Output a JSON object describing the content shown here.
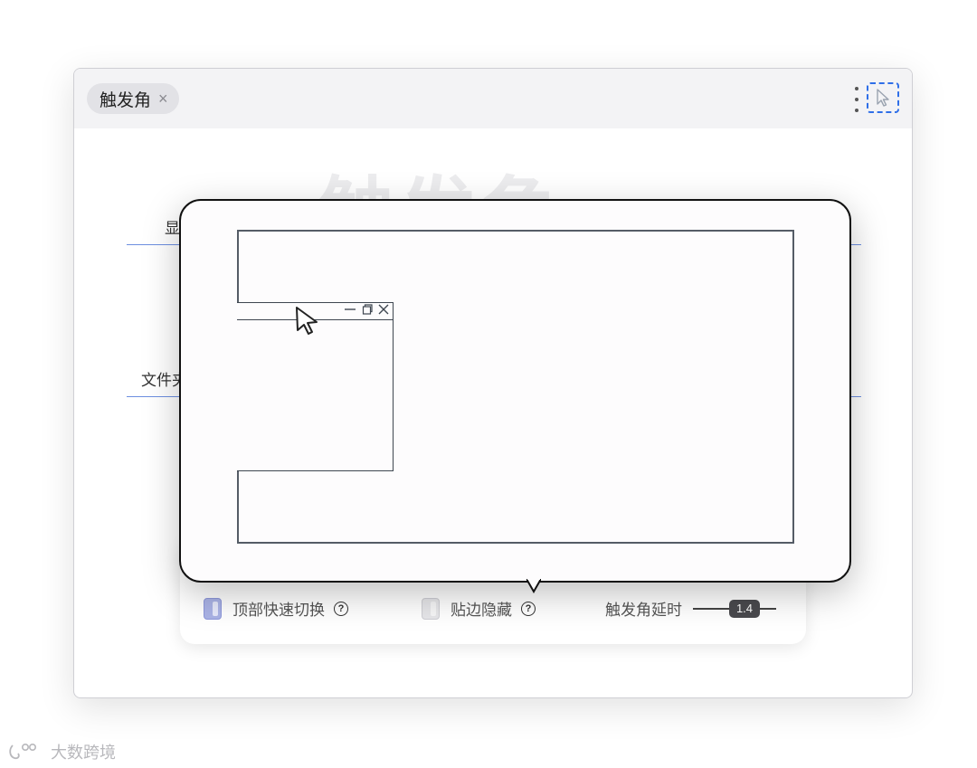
{
  "window": {
    "tab_label": "触发角",
    "tab_close": "×",
    "watermark": "触发角"
  },
  "form": {
    "label_display": "显",
    "label_file": "文件夹"
  },
  "settings": {
    "top_switch_label": "顶部快速切换",
    "top_switch_on": true,
    "edge_hide_label": "贴边隐藏",
    "edge_hide_on": false,
    "delay_label": "触发角延时",
    "delay_value": "1.4",
    "help_glyph": "?"
  },
  "brand": {
    "name": "大数跨境"
  },
  "colors": {
    "accent": "#2f6fe8",
    "toggle_on": "#aab3e6",
    "input_line": "#6d8fe0"
  }
}
